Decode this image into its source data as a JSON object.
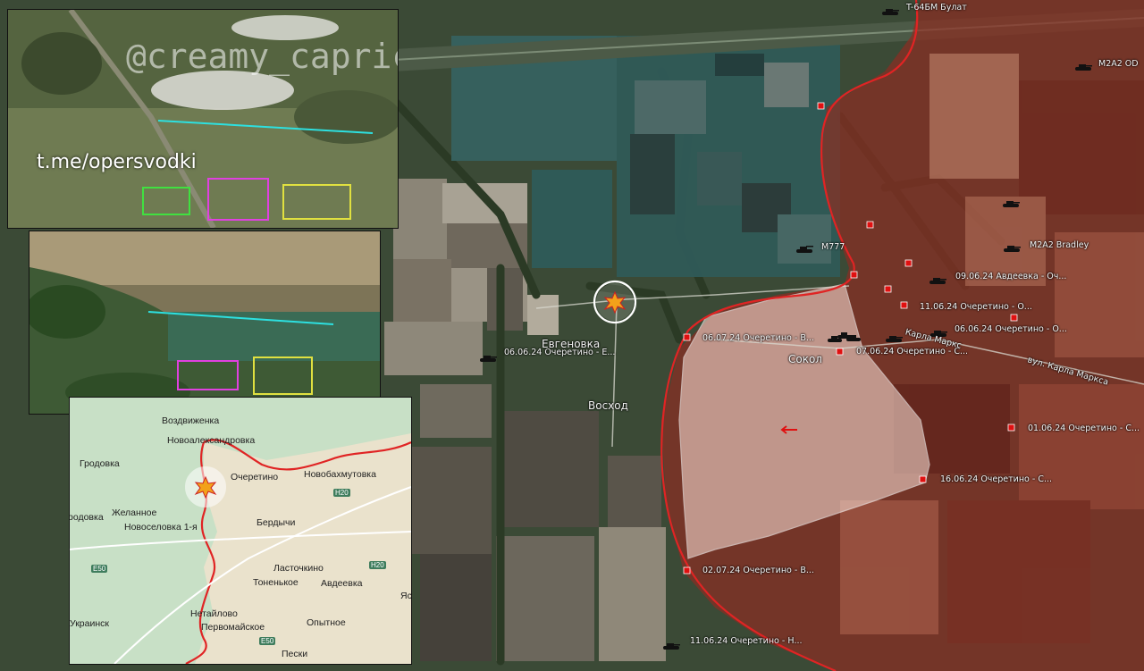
{
  "map": {
    "towns": {
      "evgenovka": "Евгеновка",
      "voskhod": "Восход",
      "sokol": "Сокол",
      "street": "вул. Карла Маркса",
      "street_short": "Карла Маркс"
    },
    "vehicles": {
      "t64": "T-64БМ Булат",
      "m2a2_top": "M2A2 OD",
      "m777": "M777",
      "m2a2_bradley": "M2A2 Bradley"
    },
    "events": [
      {
        "date": "09.06.24",
        "text": "09.06.24 Авдеевка - Оч..."
      },
      {
        "date": "11.06.24",
        "text": "11.06.24 Очеретино - О..."
      },
      {
        "date": "06.06.24",
        "text": "06.06.24 Очеретино - О..."
      },
      {
        "date": "06.07.24",
        "text": "06.07.24 Очеретино - В..."
      },
      {
        "date": "07.06.24",
        "text": "07.06.24 Очеретино - С..."
      },
      {
        "date": "06.06.24",
        "text": "06.06.24 Очеретино - Е..."
      },
      {
        "date": "01.06.24",
        "text": "01.06.24 Очеретино - С..."
      },
      {
        "date": "16.06.24",
        "text": "16.06.24 Очеретино - С..."
      },
      {
        "date": "02.07.24",
        "text": "02.07.24 Очеретино - В..."
      },
      {
        "date": "11.06.24",
        "text": "11.06.24 Очеретино - Н..."
      }
    ]
  },
  "drone_panel_top": {
    "watermark": "@creamy_caprice",
    "channel": "t.me/opersvodki"
  },
  "inset_map": {
    "towns": [
      "Воздвиженка",
      "Новоалександровка",
      "Гродовка",
      "Очеретино",
      "Новобахмутовка",
      "Желанное",
      "Новоселовка 1-я",
      "Бердычи",
      "Ласточкино",
      "Тоненькое",
      "Авдеевка",
      "Нетайлово",
      "Первомайское",
      "Опытное",
      "Пески",
      "Украинск",
      "родовка",
      "Яс"
    ],
    "roads": [
      "H20",
      "H20",
      "E50",
      "E50"
    ]
  },
  "colors": {
    "front_line": "#e02424",
    "occupied_fill": "#8a2e22",
    "contested_fill": "#efd2c8",
    "marker": "#e01010",
    "cyan_line": "#2de0e0"
  }
}
